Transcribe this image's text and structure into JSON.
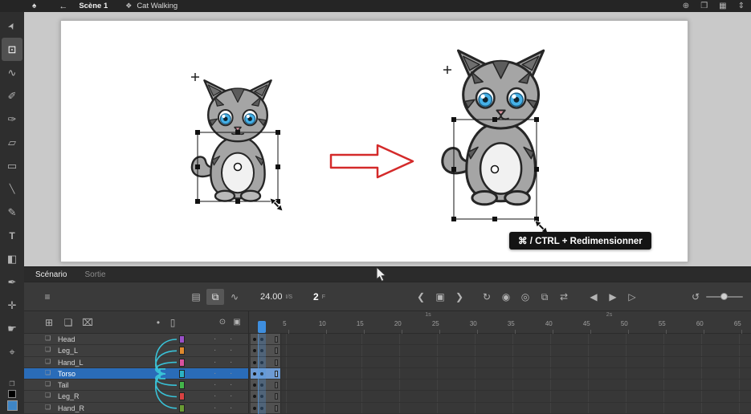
{
  "topbar": {
    "app_icon": "♠",
    "back": "←",
    "scene": "Scène 1",
    "clapper_icon": "❖",
    "symbol": "Cat Walking",
    "right_icons": [
      {
        "id": "center-stage",
        "glyph": "⊕"
      },
      {
        "id": "clip-content",
        "glyph": "❒"
      },
      {
        "id": "grid",
        "glyph": "▦"
      },
      {
        "id": "zoom-stepper",
        "glyph": "⇕"
      }
    ]
  },
  "tools": [
    {
      "id": "selection",
      "glyph": "➤",
      "active": false
    },
    {
      "id": "free-transform",
      "glyph": "⊡",
      "active": true
    },
    {
      "id": "lasso",
      "glyph": "∿",
      "active": false
    },
    {
      "id": "fluid-brush",
      "glyph": "✐",
      "active": false
    },
    {
      "id": "classic-brush",
      "glyph": "✑",
      "active": false
    },
    {
      "id": "eraser",
      "glyph": "▱",
      "active": false
    },
    {
      "id": "rectangle",
      "glyph": "▭",
      "active": false
    },
    {
      "id": "line",
      "glyph": "╲",
      "active": false
    },
    {
      "id": "pencil",
      "glyph": "✎",
      "active": false
    },
    {
      "id": "text",
      "glyph": "T",
      "active": false
    },
    {
      "id": "paint-bucket",
      "glyph": "◧",
      "active": false
    },
    {
      "id": "eyedropper",
      "glyph": "✒",
      "active": false
    },
    {
      "id": "asset-warp",
      "glyph": "✛",
      "active": false
    },
    {
      "id": "hand",
      "glyph": "☛",
      "active": false
    },
    {
      "id": "zoom",
      "glyph": "⌖",
      "active": false
    }
  ],
  "swatches": {
    "swap_icon": "❐",
    "stroke": "#000000",
    "fill": "#3f86c6"
  },
  "stage": {
    "tooltip": "⌘ / CTRL + Redimensionner"
  },
  "timeline": {
    "tabs": [
      {
        "id": "scenario",
        "label": "Scénario",
        "active": true
      },
      {
        "id": "sortie",
        "label": "Sortie",
        "active": false
      }
    ],
    "panel_icon": "≡",
    "center_icons": [
      {
        "id": "camera",
        "glyph": "▤",
        "active": false
      },
      {
        "id": "advanced-layers",
        "glyph": "⧉",
        "active": true
      },
      {
        "id": "graph-editor",
        "glyph": "∿",
        "active": false
      }
    ],
    "fps": "24.00",
    "fps_unit": "I/S",
    "frame": "2",
    "frame_unit": "F",
    "nav_icons": [
      {
        "id": "prev-keyframe",
        "glyph": "❮"
      },
      {
        "id": "center-playhead",
        "glyph": "▣"
      },
      {
        "id": "next-keyframe",
        "glyph": "❯"
      }
    ],
    "onion_icons": [
      {
        "id": "loop",
        "glyph": "↻"
      },
      {
        "id": "onion-skin",
        "glyph": "◉"
      },
      {
        "id": "onion-outlines",
        "glyph": "◎"
      },
      {
        "id": "edit-multiple-frames",
        "glyph": "⧉"
      },
      {
        "id": "frame-span",
        "glyph": "⇄"
      }
    ],
    "transport_icons": [
      {
        "id": "step-back",
        "glyph": "◀"
      },
      {
        "id": "play",
        "glyph": "▶"
      },
      {
        "id": "step-forward",
        "glyph": "▷"
      }
    ],
    "right_icons": [
      {
        "id": "reset-timeline-zoom",
        "glyph": "↺"
      }
    ],
    "layer_tools": [
      {
        "id": "new-layer",
        "glyph": "⊞"
      },
      {
        "id": "new-folder",
        "glyph": "❏"
      },
      {
        "id": "delete-layer",
        "glyph": "⌧"
      }
    ],
    "layer_head_right": [
      {
        "id": "highlight-dot",
        "glyph": "•"
      },
      {
        "id": "parent-view",
        "glyph": "▯"
      }
    ],
    "col_icons": [
      {
        "id": "show-hide",
        "glyph": "⊙"
      },
      {
        "id": "lock",
        "glyph": "▣"
      }
    ],
    "ruler_numbers": [
      5,
      10,
      15,
      20,
      25,
      30,
      35,
      40,
      45,
      50,
      55,
      60,
      65
    ],
    "seconds": [
      {
        "label": "1s",
        "frame": 24
      },
      {
        "label": "2s",
        "frame": 48
      }
    ],
    "playhead_frame": 2,
    "keyframe_dots": [
      1,
      2
    ],
    "layers": [
      {
        "name": "Head",
        "color": "#9a50c8",
        "selected": false
      },
      {
        "name": "Leg_L",
        "color": "#e08a2e",
        "selected": false
      },
      {
        "name": "Hand_L",
        "color": "#d9529e",
        "selected": false
      },
      {
        "name": "Torso",
        "color": "#2bb3c4",
        "selected": true
      },
      {
        "name": "Tail",
        "color": "#43b54a",
        "selected": false
      },
      {
        "name": "Leg_R",
        "color": "#d94242",
        "selected": false
      },
      {
        "name": "Hand_R",
        "color": "#6a9c34",
        "selected": false
      }
    ],
    "wire_color": "#39c2d7"
  }
}
